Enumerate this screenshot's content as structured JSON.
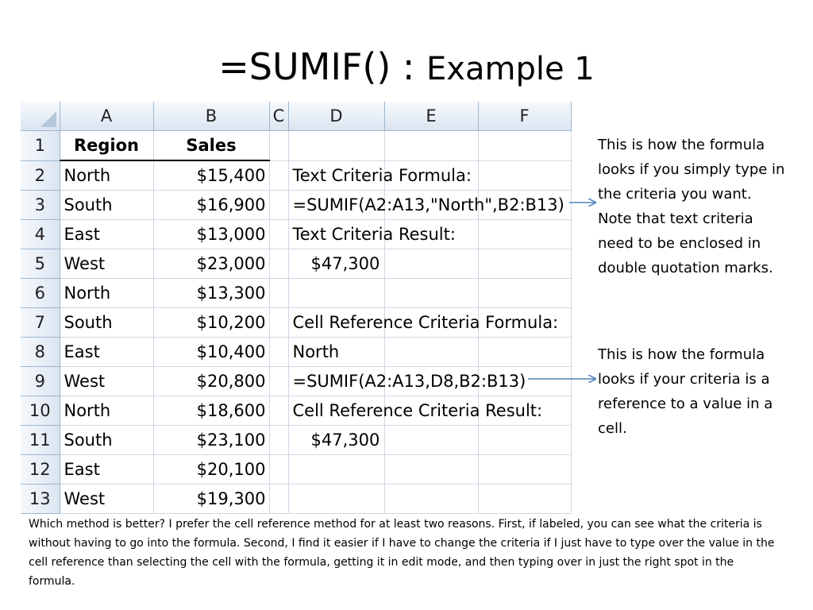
{
  "title": {
    "part1": "=SUMIF() : ",
    "part2": "Example 1"
  },
  "spreadsheet": {
    "columns": [
      "A",
      "B",
      "C",
      "D",
      "E",
      "F"
    ],
    "header": {
      "region": "Region",
      "sales": "Sales"
    },
    "rows": [
      {
        "n": "1"
      },
      {
        "n": "2",
        "region": "North",
        "sales": "$15,400"
      },
      {
        "n": "3",
        "region": "South",
        "sales": "$16,900"
      },
      {
        "n": "4",
        "region": "East",
        "sales": "$13,000"
      },
      {
        "n": "5",
        "region": "West",
        "sales": "$23,000"
      },
      {
        "n": "6",
        "region": "North",
        "sales": "$13,300"
      },
      {
        "n": "7",
        "region": "South",
        "sales": "$10,200"
      },
      {
        "n": "8",
        "region": "East",
        "sales": "$10,400"
      },
      {
        "n": "9",
        "region": "West",
        "sales": "$20,800"
      },
      {
        "n": "10",
        "region": "North",
        "sales": "$18,600"
      },
      {
        "n": "11",
        "region": "South",
        "sales": "$23,100"
      },
      {
        "n": "12",
        "region": "East",
        "sales": "$20,100"
      },
      {
        "n": "13",
        "region": "West",
        "sales": "$19,300"
      }
    ],
    "d_cells": {
      "d2": "Text Criteria Formula:",
      "d3": "=SUMIF(A2:A13,\"North\",B2:B13)",
      "d4": "Text Criteria Result:",
      "d5": "$47,300",
      "d7": "Cell Reference Criteria Formula:",
      "d8": "North",
      "d9": "=SUMIF(A2:A13,D8,B2:B13)",
      "d10": "Cell Reference Criteria Result:",
      "d11": "$47,300"
    }
  },
  "notes": {
    "note1": "This is how the formula looks if you simply type in the criteria you want.  Note that text criteria need to be enclosed in double quotation marks.",
    "note2": "This is how the formula looks if your criteria is a reference to a value in a cell."
  },
  "colors": {
    "arrow": "#4f81bd",
    "header_fill": "#dbe5f1",
    "gridline": "#d0d7e5"
  },
  "footer": "Which method is better? I prefer the cell reference method for at least two reasons. First, if labeled, you can see what the criteria is without having to go into the formula.  Second, I find it easier if I have to change the criteria if I just have to type over the value in the cell reference than selecting the cell with the formula, getting it in edit mode, and then typing over in just the right spot in the formula."
}
